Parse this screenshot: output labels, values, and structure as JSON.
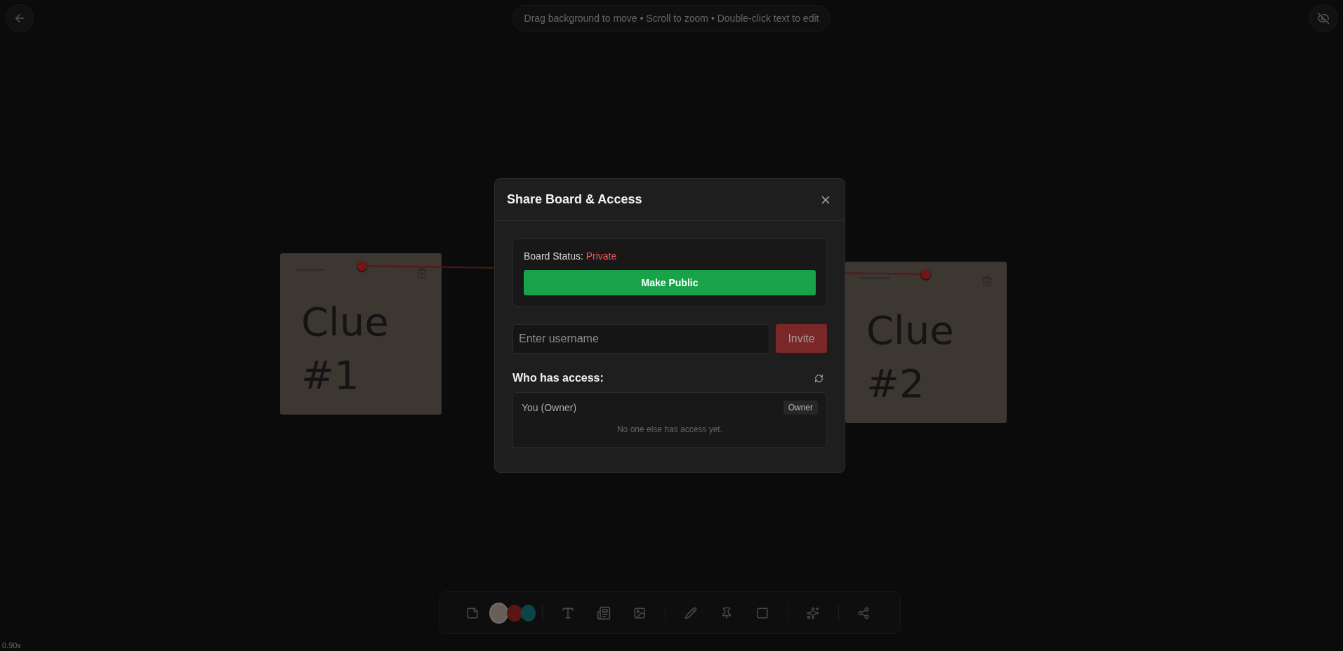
{
  "hint": "Drag background to move • Scroll to zoom • Double-click text to edit",
  "zoom_level": "0.90x",
  "notes": [
    {
      "text": "Clue #1"
    },
    {
      "text": "Clue #2"
    }
  ],
  "toolbar": {
    "swatches": [
      {
        "color": "#675f57",
        "selected": true
      },
      {
        "color": "#5a1515",
        "selected": false
      },
      {
        "color": "#0b4449",
        "selected": false
      }
    ]
  },
  "dialog": {
    "title": "Share Board & Access",
    "status_label": "Board Status:",
    "status_value": "Private",
    "make_public_button": "Make Public",
    "username_field": {
      "placeholder": "Enter username"
    },
    "invite_button": {
      "label": "Invite",
      "disabled": true
    },
    "access_heading": "Who has access:",
    "members": [
      {
        "name": "You (Owner)",
        "role": "Owner"
      }
    ],
    "empty_note": "No one else has access yet."
  }
}
